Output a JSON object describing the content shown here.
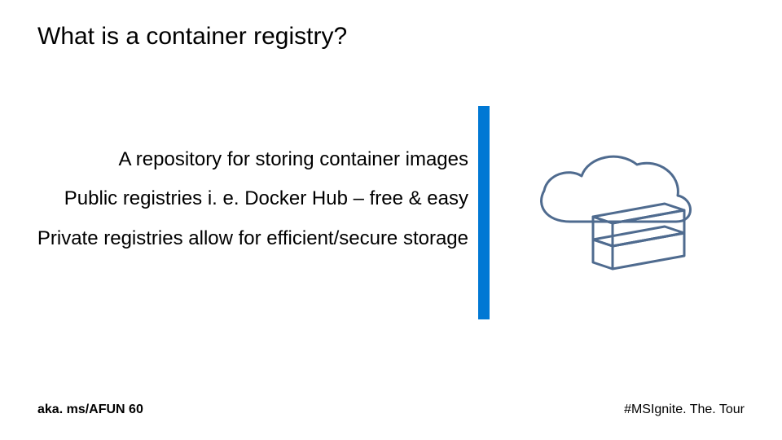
{
  "title": "What is a container registry?",
  "bullets": {
    "b1": "A repository for storing container images",
    "b2": "Public registries i. e. Docker Hub – free & easy",
    "b3": "Private registries allow for efficient/secure storage"
  },
  "footer": {
    "left": "aka. ms/AFUN 60",
    "right": "#MSIgnite. The. Tour"
  },
  "colors": {
    "accent": "#0078D4",
    "icon_stroke": "#4F6B8F"
  }
}
